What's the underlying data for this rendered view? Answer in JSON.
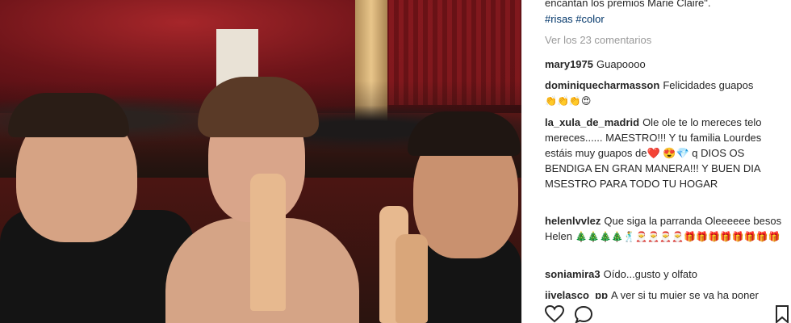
{
  "caption": {
    "text_cut": "encantan los premios Marie Claire\".",
    "tags": "#risas #color"
  },
  "view_all_comments": "Ver los 23 comentarios",
  "comments": [
    {
      "user": "mary1975",
      "text": "Guapoooo"
    },
    {
      "user": "dominiquecharmasson",
      "text": "Felicidades guapos",
      "extra": "👏👏👏😍"
    },
    {
      "user": "la_xula_de_madrid",
      "text": "Ole ole te lo mereces telo mereces...... MAESTRO!!! Y tu familia Lourdes estáis muy guapos de❤️ 😍💎 q DIOS OS BENDIGA EN GRAN MANERA!!! Y BUEN DIA MSESTRO PARA TODO TU HOGAR"
    },
    {
      "user": "helenlvvlez",
      "text": "Que siga la parranda Oleeeeee besos Helen",
      "extra": "🎄🎄🎄🎄🕺🎅🎅🎅🎅🎁🎁🎁🎁🎁🎁🎁🎁"
    },
    {
      "user": "soniamira3",
      "text": "Oído...gusto y olfato"
    },
    {
      "user": "jjvelasco_pp",
      "text": "A ver si tu mujer se va ha poner"
    }
  ],
  "icons": {
    "like": "heart-icon",
    "comment": "comment-icon",
    "save": "bookmark-icon"
  }
}
